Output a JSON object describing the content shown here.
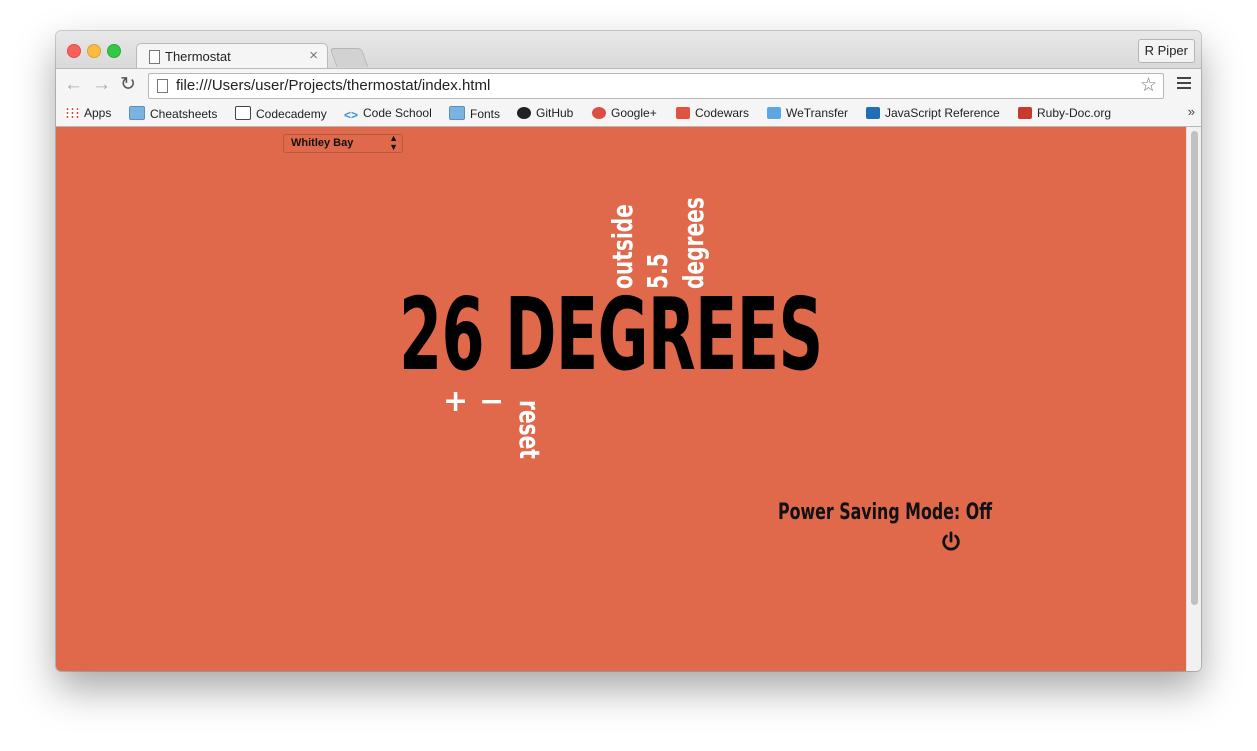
{
  "browser": {
    "tab_title": "Thermostat",
    "tab_close": "×",
    "profile": "R Piper",
    "url": "file:///Users/user/Projects/thermostat/index.html",
    "nav": {
      "back": "←",
      "forward": "→",
      "reload": "↻"
    },
    "star": "☆",
    "bookmarks": [
      {
        "label": "Apps",
        "icon": "apps-icon"
      },
      {
        "label": "Cheatsheets",
        "icon": "folder-icon"
      },
      {
        "label": "Codecademy",
        "icon": "codecademy-icon"
      },
      {
        "label": "Code School",
        "icon": "code-icon"
      },
      {
        "label": "Fonts",
        "icon": "folder-icon"
      },
      {
        "label": "GitHub",
        "icon": "github-icon"
      },
      {
        "label": "Google+",
        "icon": "google-plus-icon"
      },
      {
        "label": "Codewars",
        "icon": "codewars-icon"
      },
      {
        "label": "WeTransfer",
        "icon": "wetransfer-icon"
      },
      {
        "label": "JavaScript Reference",
        "icon": "javascript-reference-icon"
      },
      {
        "label": "Ruby-Doc.org",
        "icon": "ruby-doc-icon"
      }
    ],
    "more": "»"
  },
  "page": {
    "background": "#e0694c",
    "city": {
      "selected": "Whitley Bay"
    },
    "temperature": "26 DEGREES",
    "outside": {
      "label": "outside",
      "value": "5.5",
      "unit": "degrees"
    },
    "controls": {
      "increase": "+",
      "decrease": "−",
      "reset": "reset"
    },
    "power_saving": "Power Saving Mode: Off"
  }
}
